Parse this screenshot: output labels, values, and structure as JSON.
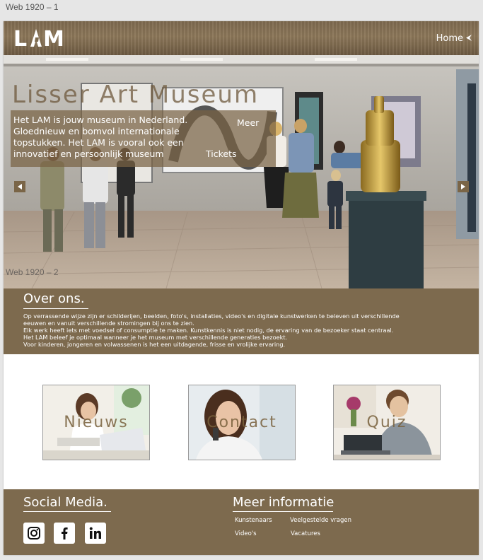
{
  "frame_labels": {
    "main": "Web 1920 – 1",
    "inner": "Web 1920 – 2"
  },
  "header": {
    "logo": "LAM",
    "home_label": "Home",
    "home_icon": "caret-left-icon"
  },
  "hero": {
    "title": "Lisser Art Museum",
    "text": "Het LAM is jouw museum in Nederland. Gloednieuw en bomvol internationale topstukken. Het LAM is vooral ook een innovatief en persoonlijk museum",
    "meer_label": "Meer",
    "tickets_label": "Tickets",
    "prev_icon": "arrow-left-icon",
    "next_icon": "arrow-right-icon"
  },
  "about": {
    "title": "Over ons.",
    "lines": [
      "Op verrassende wijze zijn er schilderijen, beelden, foto's, installaties, video's en digitale kunstwerken te beleven uit verschillende",
      "eeuwen en vanuit verschillende stromingen bij ons te zien.",
      "Elk werk heeft iets met voedsel of consumptie te maken. Kunstkennis is niet nodig, de ervaring van de bezoeker staat centraal.",
      "Het LAM beleef je optimaal wanneer je het museum met verschillende generaties bezoekt.",
      "Voor kinderen, jongeren en volwassenen is het een uitdagende, frisse en vrolijke ervaring."
    ]
  },
  "cards": [
    {
      "label": "Nieuws"
    },
    {
      "label": "Contact"
    },
    {
      "label": "Quiz"
    }
  ],
  "footer": {
    "social_title": "Social Media.",
    "social_icons": [
      "instagram-icon",
      "facebook-icon",
      "linkedin-icon"
    ],
    "info_title": "Meer informatie",
    "links": [
      "Kunstenaars",
      "Veelgestelde vragen",
      "Video's",
      "Vacatures"
    ]
  },
  "colors": {
    "brand_brown": "#7d6a4e",
    "white": "#ffffff"
  }
}
